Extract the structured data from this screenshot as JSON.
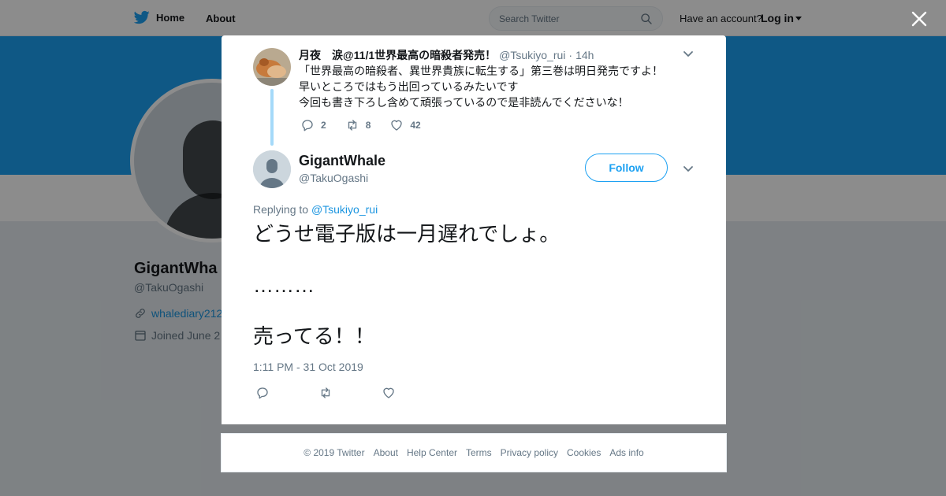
{
  "topbar": {
    "home_label": "Home",
    "about_label": "About",
    "search_placeholder": "Search Twitter",
    "have_account": "Have an account?",
    "login_label": "Log in"
  },
  "profile_bg": {
    "name": "GigantWha",
    "handle": "@TakuOgashi",
    "url": "whalediary212",
    "joined": "Joined June 2"
  },
  "ancestor_tweet": {
    "name": "月夜　涙@11/1世界最高の暗殺者発売！",
    "handle": "@Tsukiyo_rui",
    "dot": "·",
    "time": "14h",
    "lines": [
      "「世界最高の暗殺者、異世界貴族に転生する」第三巻は明日発売ですよ！",
      "早いところではもう出回っているみたいです",
      "今回も書き下ろし含めて頑張っているので是非読んでくださいな！"
    ],
    "reply_count": "2",
    "retweet_count": "8",
    "like_count": "42"
  },
  "main_tweet": {
    "name": "GigantWhale",
    "handle": "@TakuOgashi",
    "follow_label": "Follow",
    "replying_prefix": "Replying to",
    "replying_to": "@Tsukiyo_rui",
    "paragraphs": [
      "どうせ電子版は一月遅れでしょ。",
      "………",
      "売ってる！！"
    ],
    "timestamp": "1:11 PM - 31 Oct 2019"
  },
  "footer": {
    "copyright": "© 2019 Twitter",
    "links": [
      "About",
      "Help Center",
      "Terms",
      "Privacy policy",
      "Cookies",
      "Ads info"
    ]
  },
  "colors": {
    "brand_blue": "#1da1f2",
    "link_blue": "#1b95e0",
    "muted_gray": "#657786",
    "thread_line": "#a4d9f9"
  },
  "icons": {
    "logo": "twitter-bird-icon",
    "search": "search-icon",
    "close": "close-icon",
    "reply": "reply-icon",
    "retweet": "retweet-icon",
    "like": "heart-icon",
    "more": "chevron-down-icon"
  }
}
